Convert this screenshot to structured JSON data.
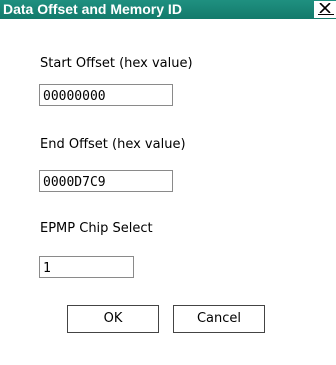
{
  "window": {
    "title": "Data Offset and Memory ID",
    "close_glyph": "×",
    "close_icon": "close-icon"
  },
  "fields": {
    "start_offset": {
      "label": "Start Offset (hex value)",
      "value": "00000000"
    },
    "end_offset": {
      "label": "End Offset (hex value)",
      "value": "0000D7C9"
    },
    "epmp_chip_select": {
      "label": "EPMP Chip Select",
      "value": "1"
    }
  },
  "buttons": {
    "ok_label": "OK",
    "cancel_label": "Cancel"
  },
  "colors": {
    "title_bar": "#15806f",
    "title_text": "#ffffff"
  }
}
